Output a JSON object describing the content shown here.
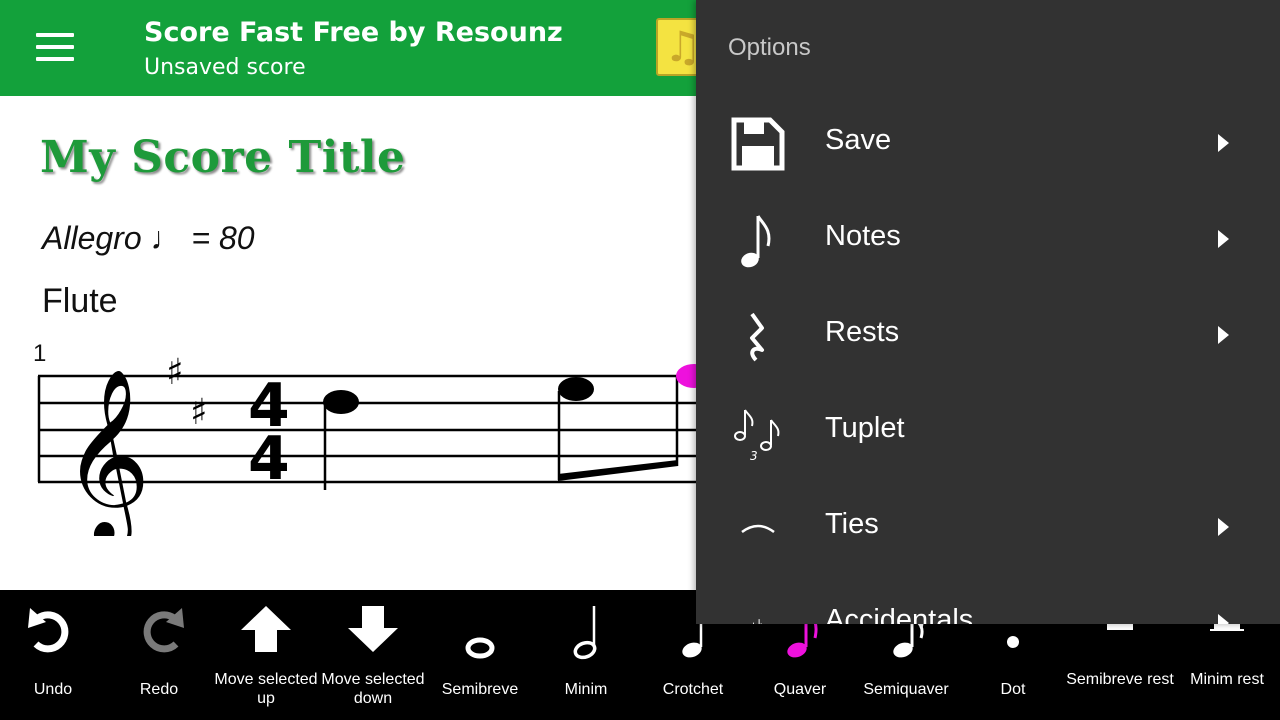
{
  "topbar": {
    "title": "Score Fast Free by Resounz",
    "subtitle": "Unsaved score"
  },
  "score": {
    "title": "My Score Title",
    "tempo_text": "Allegro",
    "tempo_value": "= 80",
    "instrument": "Flute",
    "bar_number": "1",
    "time_signature_top": "4",
    "time_signature_bottom": "4",
    "selected_note_color": "#ee11dd"
  },
  "options": {
    "header": "Options",
    "items": [
      {
        "label": "Save",
        "icon": "save-icon"
      },
      {
        "label": "Notes",
        "icon": "quaver-note-icon"
      },
      {
        "label": "Rests",
        "icon": "crotchet-rest-icon"
      },
      {
        "label": "Tuplet",
        "icon": "triplet-icon"
      },
      {
        "label": "Ties",
        "icon": "tie-icon"
      },
      {
        "label": "Accidentals",
        "icon": "sharp-icon"
      }
    ]
  },
  "toolbar": {
    "items": [
      {
        "label": "Undo",
        "icon": "undo-icon"
      },
      {
        "label": "Redo",
        "icon": "redo-icon"
      },
      {
        "label": "Move selected up",
        "icon": "arrow-up-icon"
      },
      {
        "label": "Move selected down",
        "icon": "arrow-down-icon"
      },
      {
        "label": "Semibreve",
        "icon": "semibreve-icon"
      },
      {
        "label": "Minim",
        "icon": "minim-icon"
      },
      {
        "label": "Crotchet",
        "icon": "crotchet-icon"
      },
      {
        "label": "Quaver",
        "icon": "quaver-icon",
        "selected": true
      },
      {
        "label": "Semiquaver",
        "icon": "semiquaver-icon"
      },
      {
        "label": "Dot",
        "icon": "dot-icon"
      },
      {
        "label": "Semibreve rest",
        "icon": "semibreve-rest-icon"
      },
      {
        "label": "Minim rest",
        "icon": "minim-rest-icon"
      }
    ],
    "selected_color": "#ee11dd",
    "disabled_color": "#7a7a7a"
  }
}
